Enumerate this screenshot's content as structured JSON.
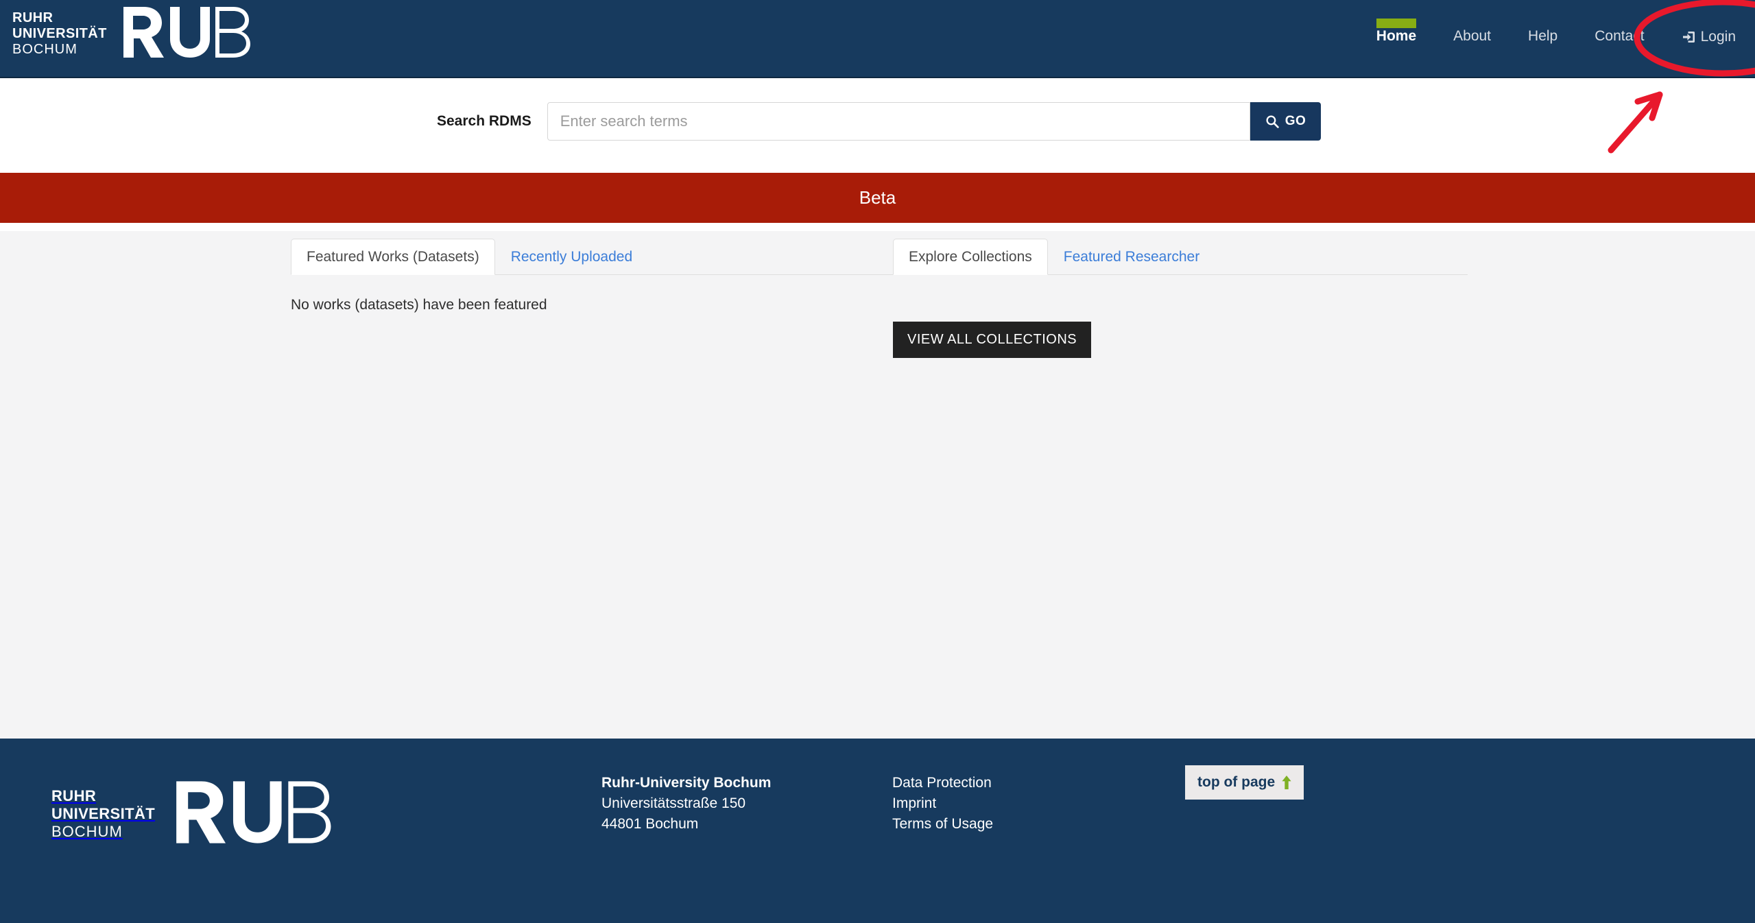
{
  "header": {
    "logo": {
      "line1": "RUHR",
      "line2": "UNIVERSITÄT",
      "line3": "BOCHUM",
      "wordmark": "RUB"
    },
    "nav": [
      {
        "label": "Home",
        "active": true
      },
      {
        "label": "About",
        "active": false
      },
      {
        "label": "Help",
        "active": false
      },
      {
        "label": "Contact",
        "active": false
      }
    ],
    "login": {
      "label": "Login",
      "icon": "sign-in-icon"
    },
    "colors": {
      "navy": "#173a5e",
      "active_underline_green": "#87ad14"
    }
  },
  "search": {
    "label": "Search RDMS",
    "placeholder": "Enter search terms",
    "value": "",
    "button_label": "GO",
    "button_icon": "search-icon"
  },
  "beta_banner": {
    "text": "Beta",
    "color": "#a81c08"
  },
  "main": {
    "left_panel": {
      "tabs": [
        {
          "label": "Featured Works (Datasets)",
          "active": true
        },
        {
          "label": "Recently Uploaded",
          "active": false
        }
      ],
      "empty_message": "No works (datasets) have been featured"
    },
    "right_panel": {
      "tabs": [
        {
          "label": "Explore Collections",
          "active": true
        },
        {
          "label": "Featured Researcher",
          "active": false
        }
      ],
      "view_all_button": "VIEW ALL COLLECTIONS"
    }
  },
  "footer": {
    "logo": {
      "line1": "RUHR",
      "line2": "UNIVERSITÄT",
      "line3": "BOCHUM",
      "wordmark": "RUB"
    },
    "address": {
      "title": "Ruhr-University Bochum",
      "street": "Universitätsstraße 150",
      "city": "44801 Bochum"
    },
    "links": [
      {
        "label": "Data Protection"
      },
      {
        "label": "Imprint"
      },
      {
        "label": "Terms of Usage"
      }
    ],
    "top_of_page": {
      "label": "top of page",
      "icon": "arrow-up-icon",
      "icon_color": "#7fb125"
    }
  },
  "annotations": {
    "color": "#e8192c",
    "ellipse_target": "Login",
    "arrow_points_to": "Login"
  }
}
